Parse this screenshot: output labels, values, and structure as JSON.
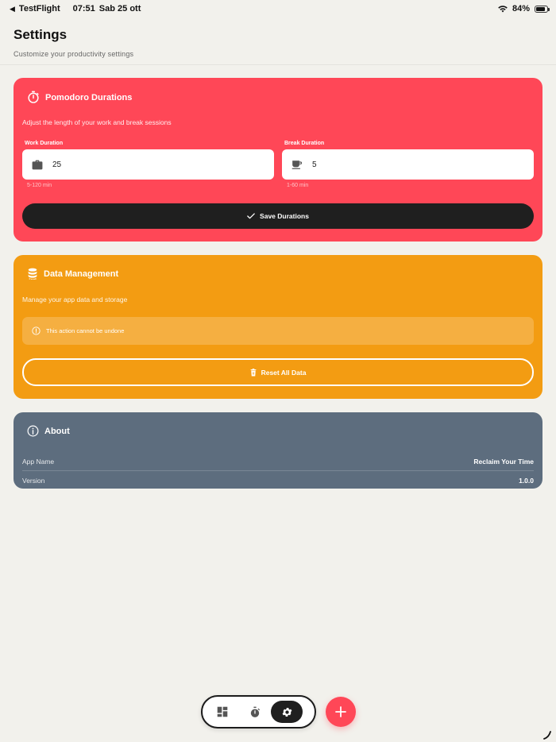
{
  "status_bar": {
    "back_app": "TestFlight",
    "time": "07:51",
    "date": "Sab 25 ott",
    "battery": "84%",
    "battery_level": 0.84
  },
  "header": {
    "title": "Settings",
    "subtitle": "Customize your productivity settings"
  },
  "pomodoro": {
    "title": "Pomodoro Durations",
    "description": "Adjust the length of your work and break sessions",
    "work": {
      "label": "Work Duration",
      "value": "25",
      "hint": "5-120 min",
      "icon": "briefcase-icon"
    },
    "break": {
      "label": "Break Duration",
      "value": "5",
      "hint": "1-60 min",
      "icon": "coffee-icon"
    },
    "save_label": "Save Durations",
    "color": "#ff4757"
  },
  "data_management": {
    "title": "Data Management",
    "description": "Manage your app data and storage",
    "warning": "This action cannot be undone",
    "reset_label": "Reset All Data",
    "color": "#f39c12"
  },
  "about": {
    "title": "About",
    "rows": [
      {
        "key": "App Name",
        "value": "Reclaim Your Time"
      },
      {
        "key": "Version",
        "value": "1.0.0"
      }
    ],
    "color": "#5d6d7e"
  },
  "tabbar": {
    "tabs": [
      {
        "name": "dashboard",
        "icon": "dashboard-icon",
        "active": false
      },
      {
        "name": "timer",
        "icon": "stopwatch-icon",
        "active": false
      },
      {
        "name": "settings",
        "icon": "gear-icon",
        "active": true
      }
    ],
    "fab_icon": "plus-icon"
  }
}
